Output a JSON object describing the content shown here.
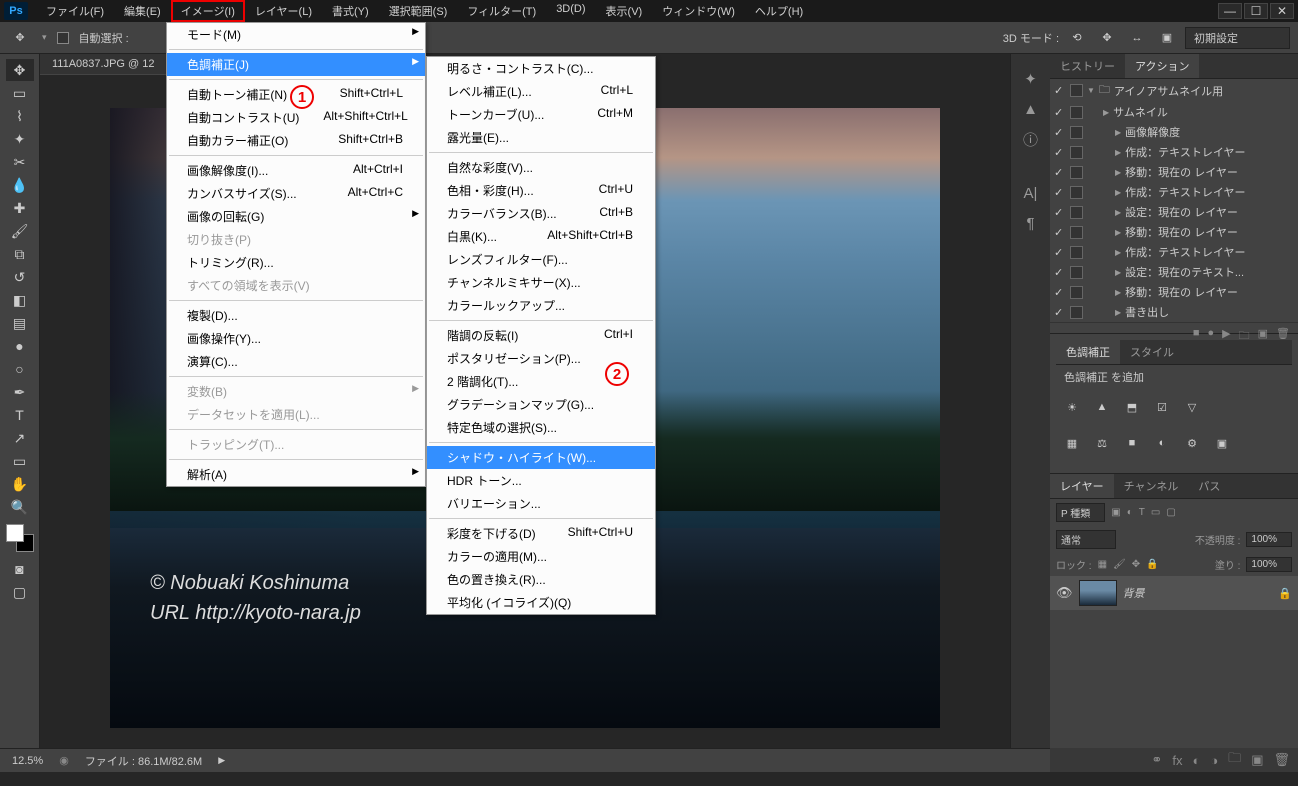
{
  "menubar": [
    "ファイル(F)",
    "編集(E)",
    "イメージ(I)",
    "レイヤー(L)",
    "書式(Y)",
    "選択範囲(S)",
    "フィルター(T)",
    "3D(D)",
    "表示(V)",
    "ウィンドウ(W)",
    "ヘルプ(H)"
  ],
  "menubar_highlight_index": 2,
  "optbar": {
    "autoselect_label": "自動選択 :",
    "mode3d_label": "3D モード :",
    "preset": "初期設定"
  },
  "doc_tab": "111A0837.JPG @ 12",
  "watermark_line1": "© Nobuaki Koshinuma",
  "watermark_line2": "URL http://kyoto-nara.jp",
  "dropdown1": [
    {
      "label": "モード(M)",
      "arrow": true
    },
    {
      "sep": true
    },
    {
      "label": "色調補正(J)",
      "arrow": true,
      "hl": true
    },
    {
      "sep": true
    },
    {
      "label": "自動トーン補正(N)",
      "short": "Shift+Ctrl+L"
    },
    {
      "label": "自動コントラスト(U)",
      "short": "Alt+Shift+Ctrl+L"
    },
    {
      "label": "自動カラー補正(O)",
      "short": "Shift+Ctrl+B"
    },
    {
      "sep": true
    },
    {
      "label": "画像解像度(I)...",
      "short": "Alt+Ctrl+I"
    },
    {
      "label": "カンバスサイズ(S)...",
      "short": "Alt+Ctrl+C"
    },
    {
      "label": "画像の回転(G)",
      "arrow": true
    },
    {
      "label": "切り抜き(P)",
      "disabled": true
    },
    {
      "label": "トリミング(R)..."
    },
    {
      "label": "すべての領域を表示(V)",
      "disabled": true
    },
    {
      "sep": true
    },
    {
      "label": "複製(D)..."
    },
    {
      "label": "画像操作(Y)..."
    },
    {
      "label": "演算(C)..."
    },
    {
      "sep": true
    },
    {
      "label": "変数(B)",
      "arrow": true,
      "disabled": true
    },
    {
      "label": "データセットを適用(L)...",
      "disabled": true
    },
    {
      "sep": true
    },
    {
      "label": "トラッピング(T)...",
      "disabled": true
    },
    {
      "sep": true
    },
    {
      "label": "解析(A)",
      "arrow": true
    }
  ],
  "dropdown2": [
    {
      "label": "明るさ・コントラスト(C)..."
    },
    {
      "label": "レベル補正(L)...",
      "short": "Ctrl+L"
    },
    {
      "label": "トーンカーブ(U)...",
      "short": "Ctrl+M"
    },
    {
      "label": "露光量(E)..."
    },
    {
      "sep": true
    },
    {
      "label": "自然な彩度(V)..."
    },
    {
      "label": "色相・彩度(H)...",
      "short": "Ctrl+U"
    },
    {
      "label": "カラーバランス(B)...",
      "short": "Ctrl+B"
    },
    {
      "label": "白黒(K)...",
      "short": "Alt+Shift+Ctrl+B"
    },
    {
      "label": "レンズフィルター(F)..."
    },
    {
      "label": "チャンネルミキサー(X)..."
    },
    {
      "label": "カラールックアップ..."
    },
    {
      "sep": true
    },
    {
      "label": "階調の反転(I)",
      "short": "Ctrl+I"
    },
    {
      "label": "ポスタリゼーション(P)..."
    },
    {
      "label": "2 階調化(T)..."
    },
    {
      "label": "グラデーションマップ(G)..."
    },
    {
      "label": "特定色域の選択(S)..."
    },
    {
      "sep": true
    },
    {
      "label": "シャドウ・ハイライト(W)...",
      "hl": true
    },
    {
      "label": "HDR トーン..."
    },
    {
      "label": "バリエーション..."
    },
    {
      "sep": true
    },
    {
      "label": "彩度を下げる(D)",
      "short": "Shift+Ctrl+U"
    },
    {
      "label": "カラーの適用(M)..."
    },
    {
      "label": "色の置き換え(R)..."
    },
    {
      "label": "平均化 (イコライズ)(Q)"
    }
  ],
  "annotations": {
    "one": "1",
    "two": "2"
  },
  "panels": {
    "history_tab": "ヒストリー",
    "actions_tab": "アクション",
    "action_set": "アイノアサムネイル用",
    "action_name": "サムネイル",
    "action_steps": [
      "画像解像度",
      "作成：テキストレイヤー",
      "移動：現在の レイヤー",
      "作成：テキストレイヤー",
      "設定：現在の レイヤー",
      "移動：現在の レイヤー",
      "作成：テキストレイヤー",
      "設定：現在のテキスト...",
      "移動：現在の レイヤー",
      "書き出し"
    ],
    "adj_tab1": "色調補正",
    "adj_tab2": "スタイル",
    "adj_hint": "色調補正 を追加",
    "layers_tab": "レイヤー",
    "channels_tab": "チャンネル",
    "paths_tab": "パス",
    "kind_label": "P 種類",
    "blend": "通常",
    "opacity_label": "不透明度 :",
    "opacity_val": "100%",
    "lock_label": "ロック :",
    "fill_label": "塗り :",
    "fill_val": "100%",
    "bg_layer": "背景"
  },
  "status": {
    "zoom": "12.5%",
    "doc": "ファイル : 86.1M/82.6M"
  }
}
